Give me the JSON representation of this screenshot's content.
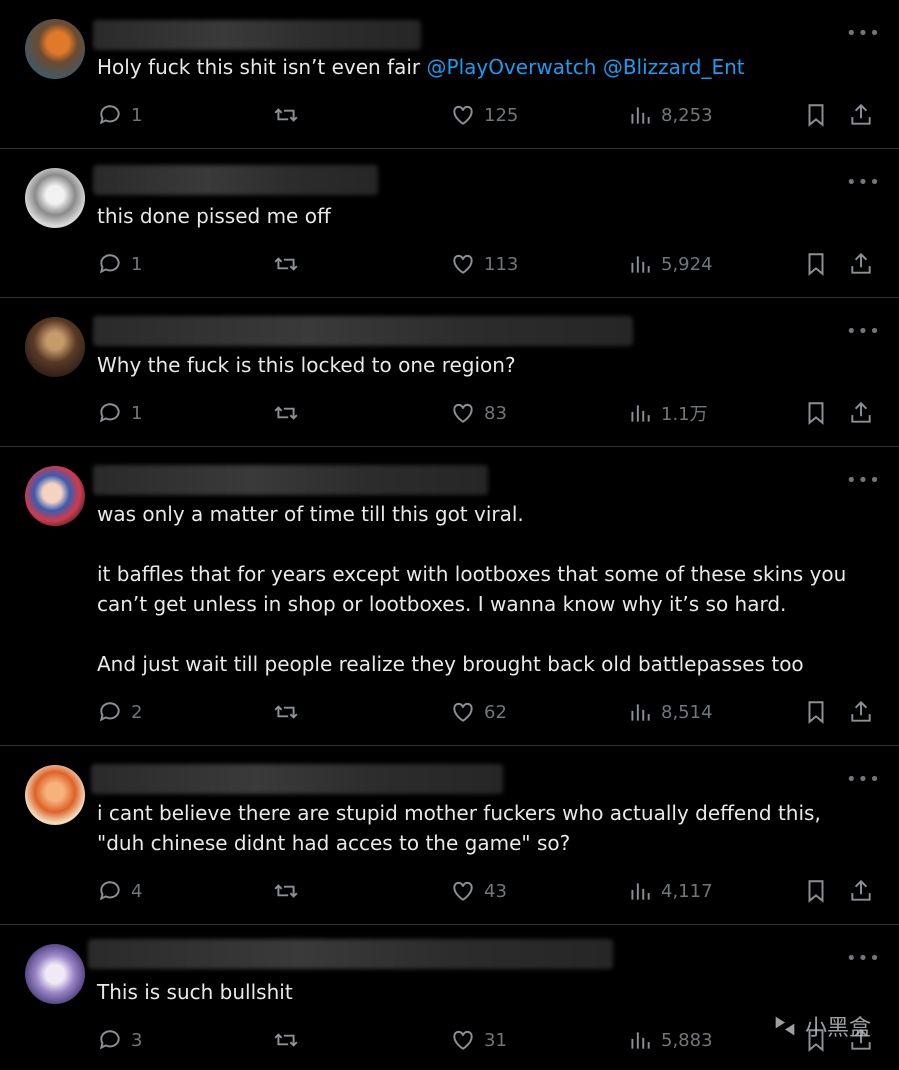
{
  "posts": [
    {
      "text": "Holy fuck this shit isn’t even fair ",
      "mentions": [
        "@PlayOverwatch",
        "@Blizzard_Ent"
      ],
      "replies": "1",
      "reposts": "",
      "likes": "125",
      "views": "8,253"
    },
    {
      "text": "this done pissed me off",
      "mentions": [],
      "replies": "1",
      "reposts": "",
      "likes": "113",
      "views": "5,924"
    },
    {
      "text": "Why the fuck is this locked to one region?",
      "mentions": [],
      "replies": "1",
      "reposts": "",
      "likes": "83",
      "views": "1.1万"
    },
    {
      "text": "was only a matter of time till this got viral.\n\nit baffles that for years except with lootboxes that some of these skins you can’t get unless in shop or lootboxes. I wanna know why it’s so hard.\n\nAnd just wait till people realize they brought back old battlepasses too",
      "mentions": [],
      "replies": "2",
      "reposts": "",
      "likes": "62",
      "views": "8,514"
    },
    {
      "text": "i cant believe there are stupid mother fuckers who actually deffend this, \"duh chinese didnt had acces to the game\" so?",
      "mentions": [],
      "replies": "4",
      "reposts": "",
      "likes": "43",
      "views": "4,117"
    },
    {
      "text": "This is such bullshit",
      "mentions": [],
      "replies": "3",
      "reposts": "",
      "likes": "31",
      "views": "5,883"
    }
  ],
  "more_glyph": "•••",
  "watermark": {
    "text": "小黑盒"
  },
  "colors": {
    "mention": "#1d9bf0",
    "text": "#e7e9ea",
    "muted": "#71767b",
    "border": "#2f3336"
  }
}
